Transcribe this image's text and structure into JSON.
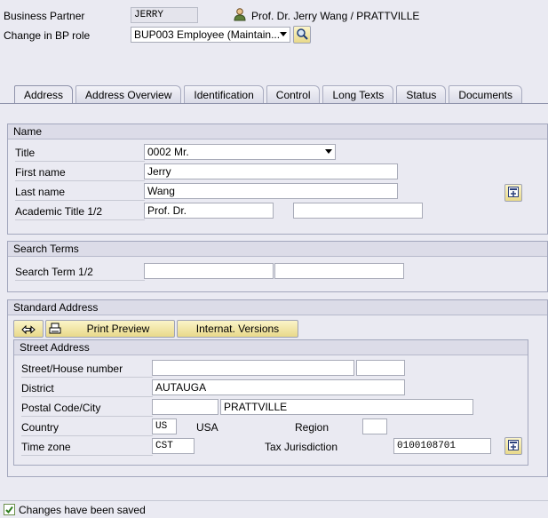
{
  "header": {
    "bp_label": "Business Partner",
    "bp_value": "JERRY",
    "bp_name": "Prof. Dr. Jerry Wang / PRATTVILLE",
    "role_label": "Change in BP role",
    "role_value": "BUP003 Employee (Maintain..."
  },
  "tabs": [
    "Address",
    "Address Overview",
    "Identification",
    "Control",
    "Long Texts",
    "Status",
    "Documents"
  ],
  "name_section": {
    "header": "Name",
    "title_label": "Title",
    "title_value": "0002 Mr.",
    "first_name_label": "First name",
    "first_name_value": "Jerry",
    "last_name_label": "Last name",
    "last_name_value": "Wang",
    "academic_label": "Academic Title 1/2",
    "academic_1": "Prof. Dr.",
    "academic_2": ""
  },
  "search_section": {
    "header": "Search Terms",
    "term_label": "Search Term 1/2",
    "term_1": "",
    "term_2": ""
  },
  "address_section": {
    "header": "Standard Address",
    "print_preview": "Print Preview",
    "internat_versions": "Internat. Versions",
    "street_header": "Street Address",
    "street_label": "Street/House number",
    "street_value": "",
    "house_value": "",
    "district_label": "District",
    "district_value": "AUTAUGA",
    "postal_label": "Postal Code/City",
    "postal_value": "",
    "city_value": "PRATTVILLE",
    "country_label": "Country",
    "country_code": "US",
    "country_name": "USA",
    "region_label": "Region",
    "region_value": "",
    "timezone_label": "Time zone",
    "timezone_value": "CST",
    "tax_label": "Tax Jurisdiction",
    "tax_value": "0100108701"
  },
  "status": {
    "message": "Changes have been saved"
  }
}
